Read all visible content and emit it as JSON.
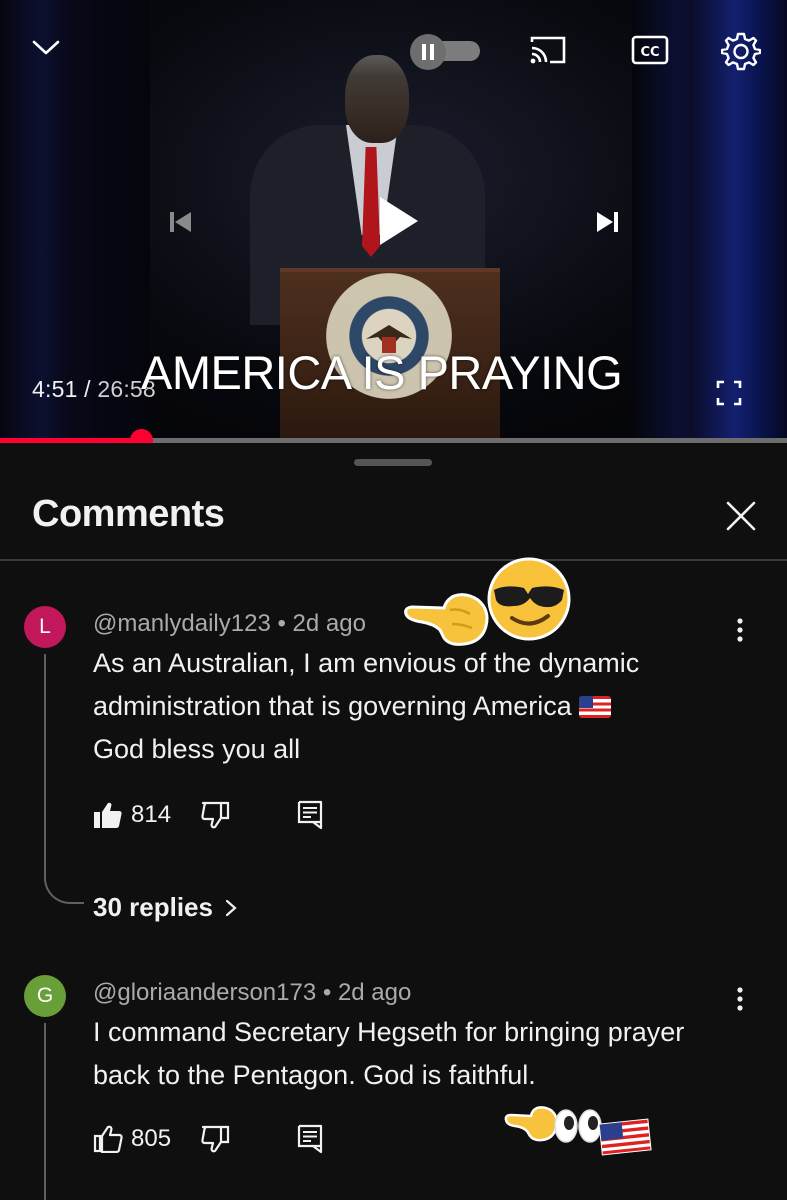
{
  "player": {
    "current_time": "4:51",
    "duration": "26:58",
    "time_separator": " / ",
    "overlay_title": "AMERICA IS PRAYING",
    "progress_fraction": 0.179,
    "autoplay": "paused",
    "cc_label": "CC",
    "seal_text": "DEPARTMENT OF DEFENSE",
    "colors": {
      "progress": "#ff0033",
      "track": "#6d6d6d"
    }
  },
  "comments_panel": {
    "title": "Comments",
    "close_icon": "close-icon"
  },
  "comments": [
    {
      "avatar_letter": "L",
      "avatar_color": "#c2185b",
      "handle": "@manlydaily123",
      "age": "2d ago",
      "body_line1": "As an Australian, I am envious of the dynamic",
      "body_line2": "administration that is governing America",
      "body_line3": "God bless you all",
      "likes": "814",
      "replies_label": "30 replies",
      "liked": true
    },
    {
      "avatar_letter": "G",
      "avatar_color": "#689f38",
      "handle": "@gloriaanderson173",
      "age": "2d ago",
      "body_line1": "I command Secretary Hegseth for bringing prayer",
      "body_line2": "back to the Pentagon. God is faithful.",
      "likes": "805",
      "liked": false
    }
  ],
  "meta_separator": " • ",
  "stickers": {
    "top": [
      "backhand-index-pointing-right",
      "smiling-face-with-sunglasses"
    ],
    "bottom": [
      "backhand-index-pointing-right",
      "eyes",
      "us-flag"
    ]
  }
}
